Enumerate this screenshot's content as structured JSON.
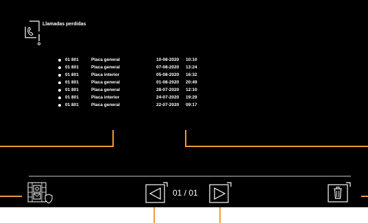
{
  "header": {
    "title": "Llamadas perdidas",
    "icon": "missed-call-icon"
  },
  "calls": [
    {
      "number": "01 801",
      "source": "Placa general",
      "date": "10-08-2020",
      "time": "10:10"
    },
    {
      "number": "01 801",
      "source": "Placa general",
      "date": "07-08-2020",
      "time": "13:24"
    },
    {
      "number": "01 801",
      "source": "Placa interior",
      "date": "05-08-2020",
      "time": "16:32"
    },
    {
      "number": "01 801",
      "source": "Placa general",
      "date": "01-08-2020",
      "time": "20:49"
    },
    {
      "number": "01 801",
      "source": "Placa general",
      "date": "28-07-2020",
      "time": "12:10"
    },
    {
      "number": "01 801",
      "source": "Placa interior",
      "date": "24-07-2020",
      "time": "19:29"
    },
    {
      "number": "01 801",
      "source": "Placa general",
      "date": "22-07-2020",
      "time": "09:17"
    }
  ],
  "footer": {
    "page_indicator": "01 / 01",
    "icons": [
      "building-intercom-icon",
      "previous-page-icon",
      "next-page-icon",
      "trash-icon"
    ]
  },
  "colors": {
    "background": "#000000",
    "text": "#ffffff",
    "callout": "#f39a3a"
  }
}
